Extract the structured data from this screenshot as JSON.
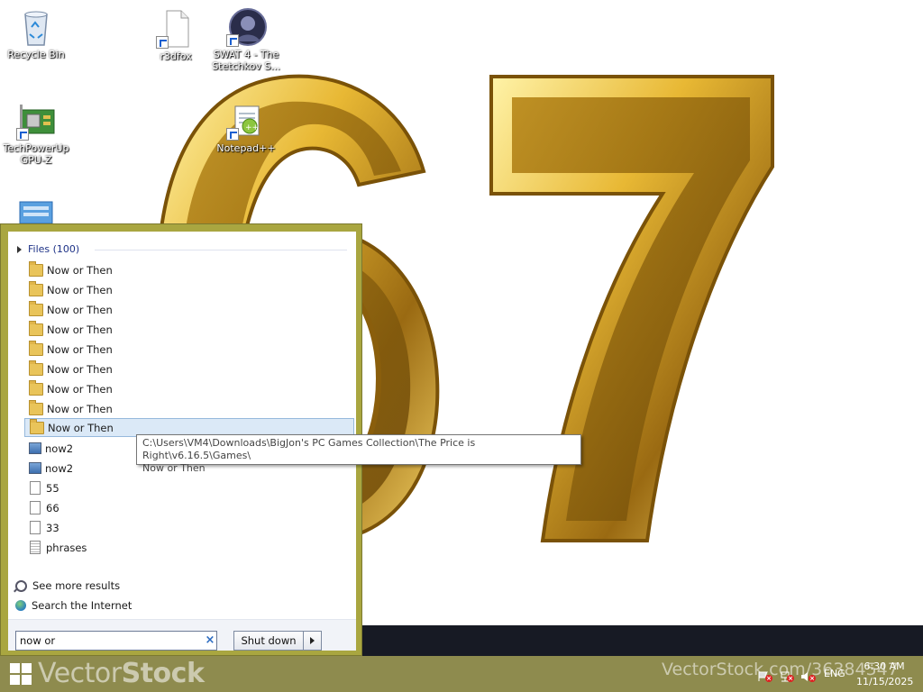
{
  "desktop": {
    "icons": [
      {
        "label": "Recycle Bin",
        "icon": "recycle-bin-icon"
      },
      {
        "label": "r3dfox",
        "icon": "file-shortcut-icon"
      },
      {
        "label": "SWAT 4 - The Stetchkov S...",
        "icon": "swat4-game-icon"
      },
      {
        "label": "TechPowerUp GPU-Z",
        "icon": "gpu-z-icon"
      },
      {
        "label": "Notepad++",
        "icon": "notepad-plus-plus-icon"
      }
    ]
  },
  "start_menu": {
    "group_header": "Files (100)",
    "results": [
      {
        "label": "Now or Then",
        "type": "folder"
      },
      {
        "label": "Now or Then",
        "type": "folder"
      },
      {
        "label": "Now or Then",
        "type": "folder"
      },
      {
        "label": "Now or Then",
        "type": "folder"
      },
      {
        "label": "Now or Then",
        "type": "folder"
      },
      {
        "label": "Now or Then",
        "type": "folder"
      },
      {
        "label": "Now or Then",
        "type": "folder"
      },
      {
        "label": "Now or Then",
        "type": "folder"
      },
      {
        "label": "Now or Then",
        "type": "folder",
        "selected": true
      },
      {
        "label": "now2",
        "type": "image"
      },
      {
        "label": "now2",
        "type": "image"
      },
      {
        "label": "55",
        "type": "file"
      },
      {
        "label": "66",
        "type": "file"
      },
      {
        "label": "33",
        "type": "file"
      },
      {
        "label": "phrases",
        "type": "text"
      }
    ],
    "see_more": "See more results",
    "search_internet": "Search the Internet",
    "search_value": "now or",
    "clear_symbol": "×",
    "shutdown_label": "Shut down"
  },
  "tooltip": {
    "line1": "C:\\Users\\VM4\\Downloads\\BigJon's PC Games Collection\\The Price is Right\\v6.16.5\\Games\\",
    "line2": "Now or Then"
  },
  "taskbar": {
    "watermark_left_a": "Vector",
    "watermark_left_b": "Stock",
    "watermark_url": "VectorStock.com/36384547",
    "language": "ENG",
    "time": "6:30 AM",
    "date": "11/15/2025"
  },
  "colors": {
    "start_menu_border": "#a9a640",
    "taskbar": "#8e8b4e",
    "selection": "#dbe9f7",
    "gold": "#d9a928"
  }
}
